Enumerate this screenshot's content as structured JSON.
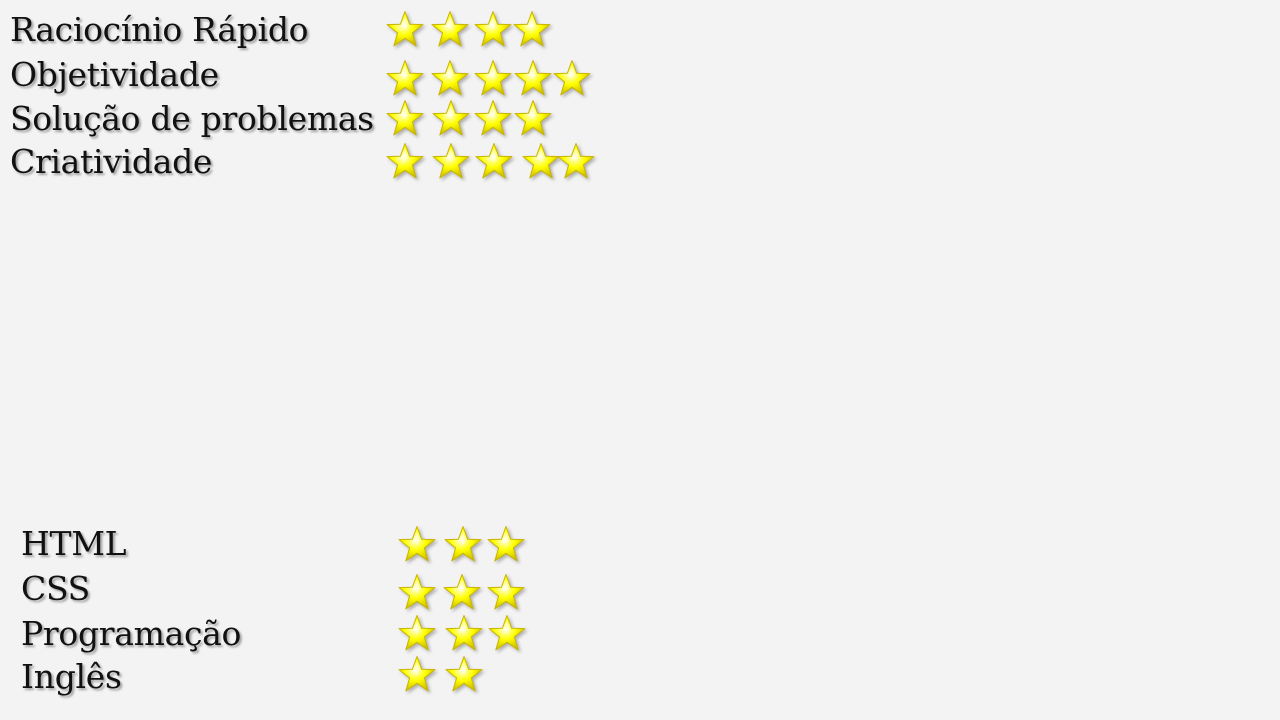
{
  "colors": {
    "background": "#f3f3f3",
    "text": "#111111",
    "star_fill": "#ffff00",
    "star_highlight": "#fffff0",
    "star_edge": "#c8b400"
  },
  "icon": "star-icon",
  "soft_skills": [
    {
      "label": "Raciocínio Rápido",
      "rating": 4
    },
    {
      "label": "Objetividade",
      "rating": 5
    },
    {
      "label": "Solução de problemas",
      "rating": 4
    },
    {
      "label": "Criatividade",
      "rating": 5
    }
  ],
  "hard_skills": [
    {
      "label": "HTML",
      "rating": 3
    },
    {
      "label": "CSS",
      "rating": 3
    },
    {
      "label": "Programação",
      "rating": 3
    },
    {
      "label": "Inglês",
      "rating": 2
    }
  ]
}
